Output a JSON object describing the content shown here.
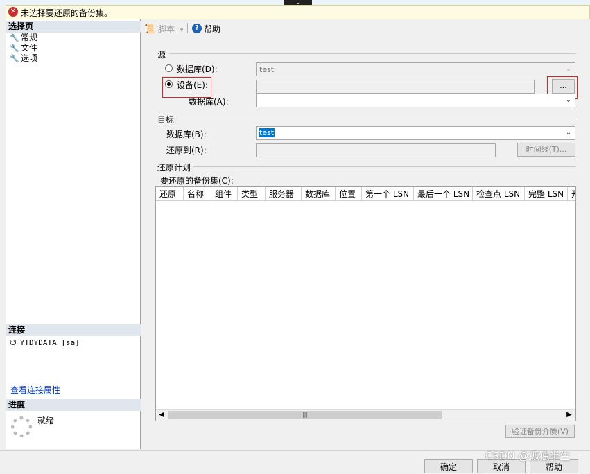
{
  "error_bar": {
    "icon": "error-icon",
    "message": "未选择要还原的备份集。"
  },
  "left": {
    "select_page_header": "选择页",
    "pages": [
      {
        "label": "常规",
        "icon": "wrench-icon"
      },
      {
        "label": "文件",
        "icon": "wrench-icon"
      },
      {
        "label": "选项",
        "icon": "wrench-icon"
      }
    ],
    "connection_header": "连接",
    "connection_name": "YTDYDATA [sa]",
    "view_connection_link": "查看连接属性",
    "progress_header": "进度",
    "progress_status": "就绪"
  },
  "toolbar": {
    "script_label": "脚本",
    "help_label": "帮助"
  },
  "source": {
    "group_label": "源",
    "database_radio_label": "数据库(D):",
    "database_value": "test",
    "device_radio_label": "设备(E):",
    "device_value": "",
    "browse_label": "...",
    "device_database_label": "数据库(A):",
    "device_database_value": ""
  },
  "target": {
    "group_label": "目标",
    "database_label": "数据库(B):",
    "database_value": "test",
    "restore_to_label": "还原到(R):",
    "restore_to_value": "",
    "timeline_button": "时间线(T)..."
  },
  "plan": {
    "group_label": "还原计划",
    "sets_label": "要还原的备份集(C):",
    "columns": [
      "还原",
      "名称",
      "组件",
      "类型",
      "服务器",
      "数据库",
      "位置",
      "第一个 LSN",
      "最后一个 LSN",
      "检查点 LSN",
      "完整 LSN",
      "开"
    ],
    "rows": [],
    "verify_button": "验证备份介质(V)"
  },
  "footer": {
    "ok": "确定",
    "cancel": "取消",
    "help": "帮助"
  },
  "watermark": "CSDN @孤独半生"
}
